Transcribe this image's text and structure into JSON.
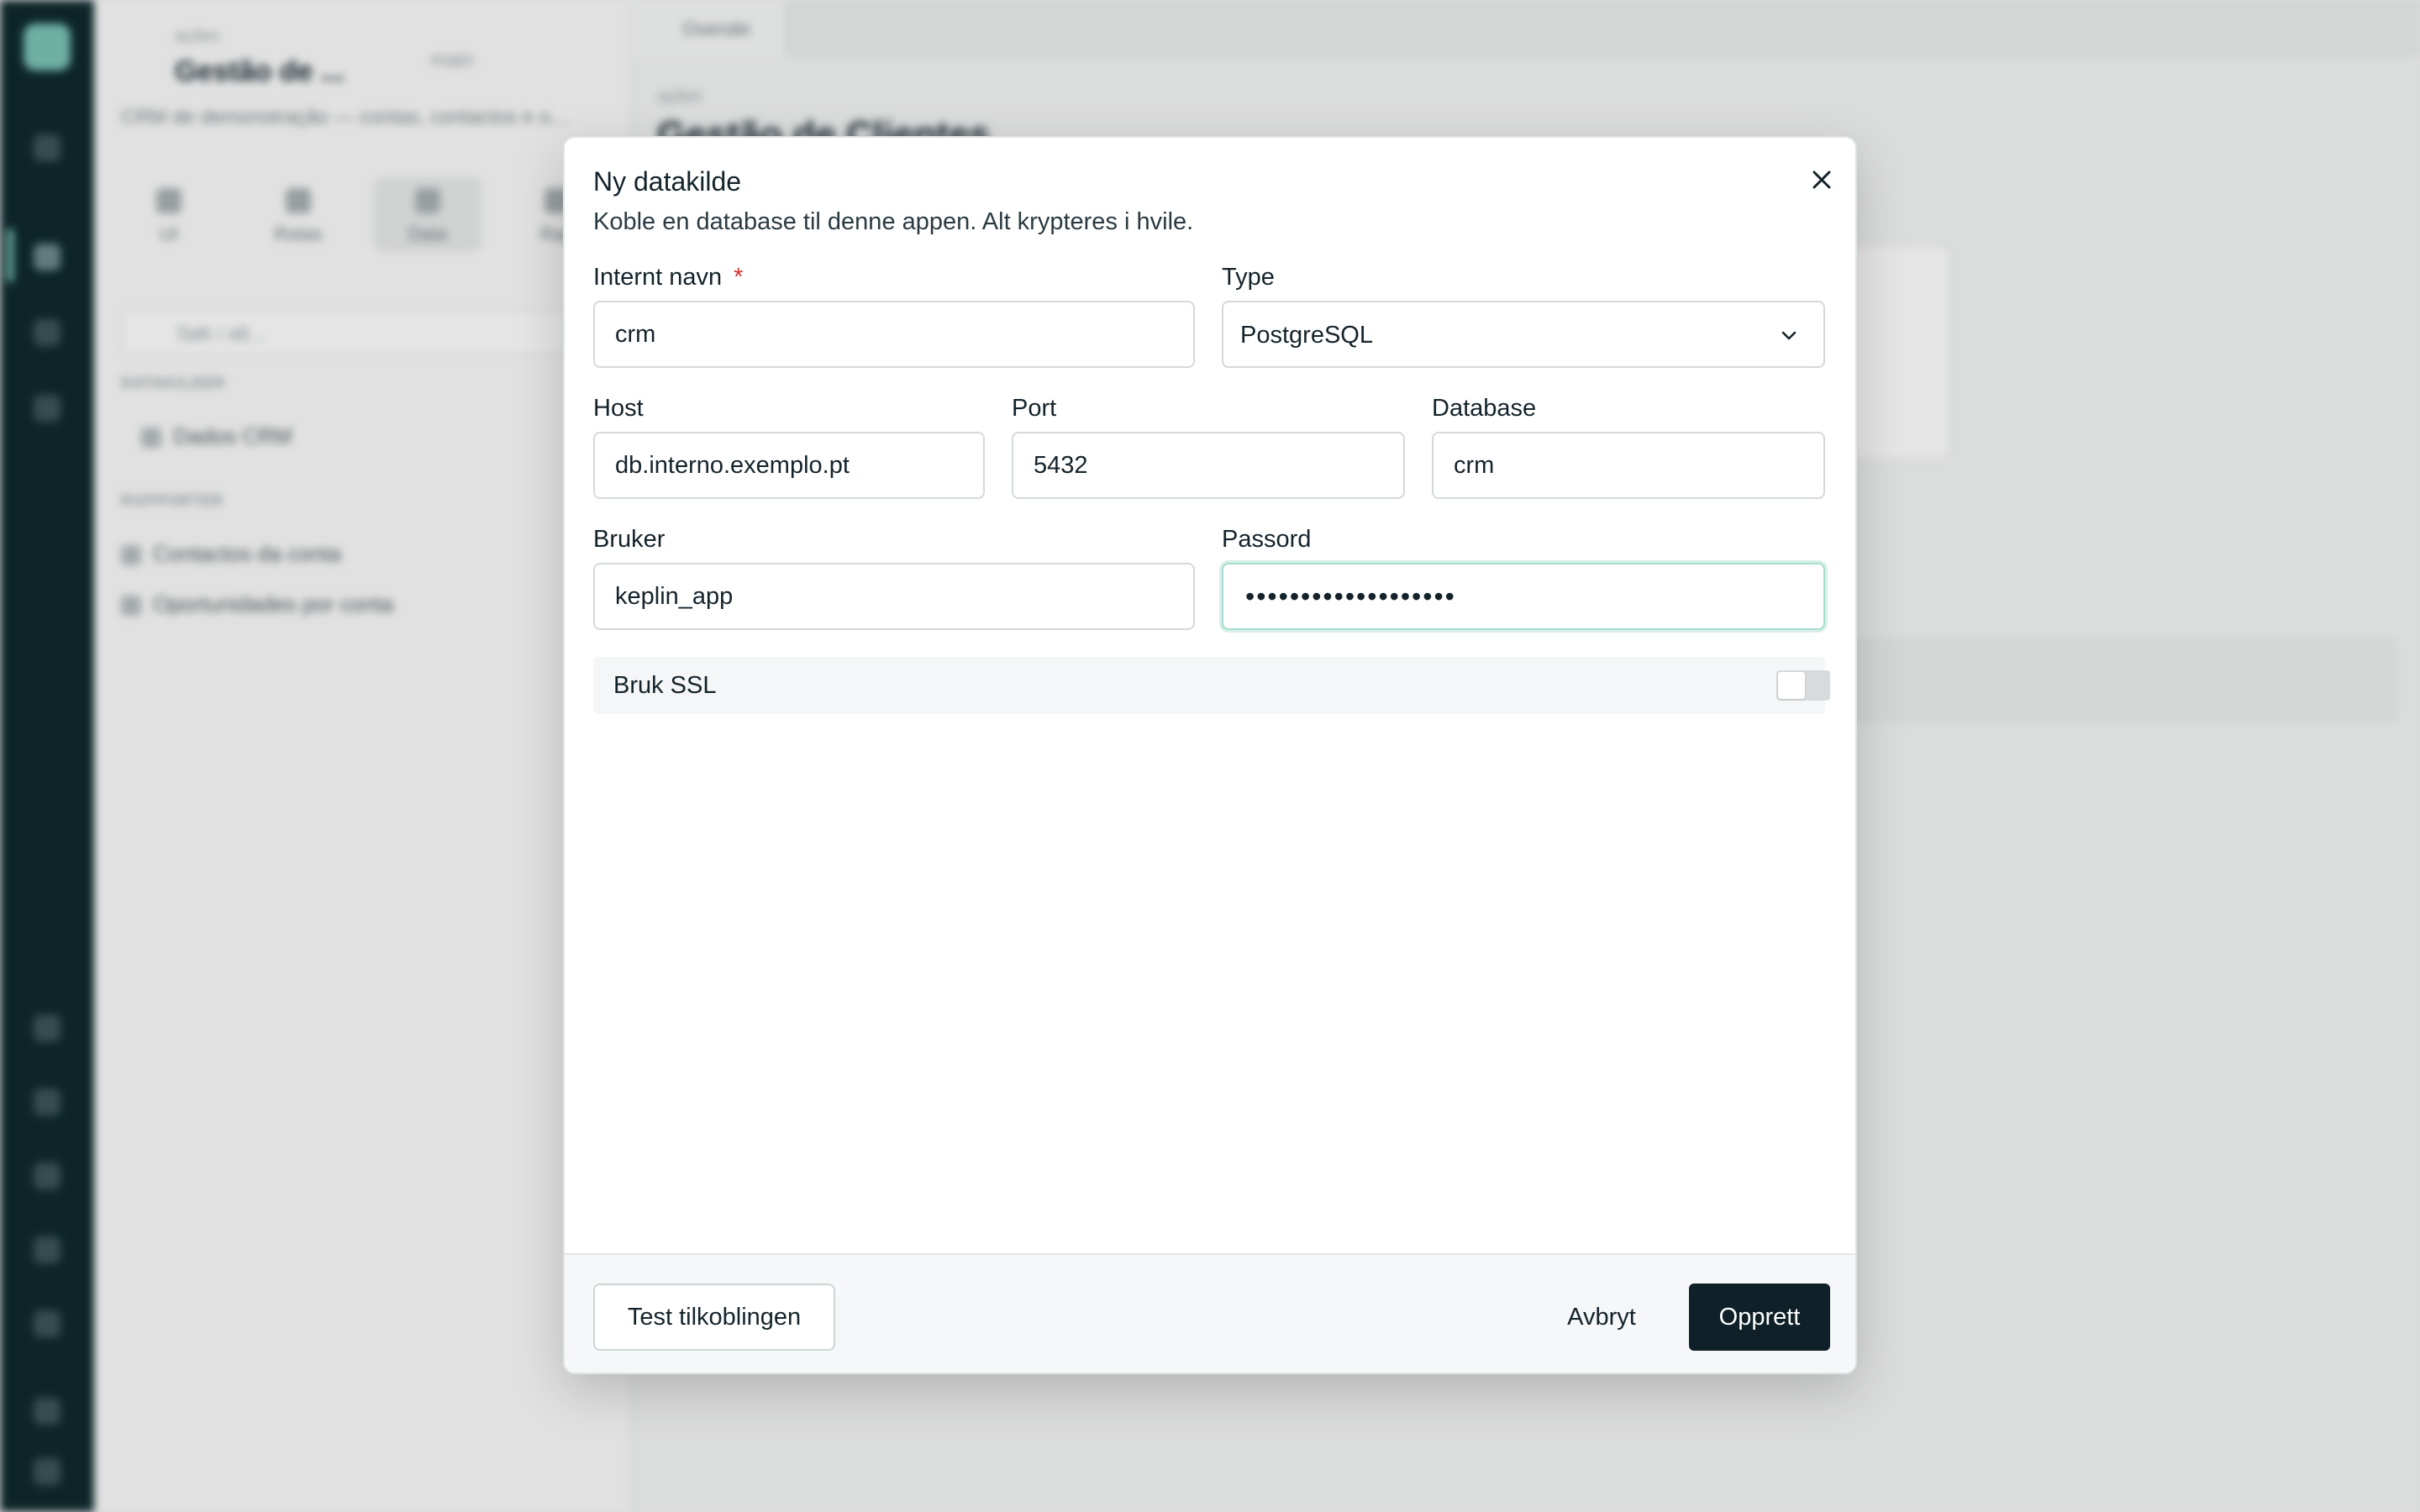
{
  "background": {
    "sidepanel": {
      "workspace_small": "ações",
      "app_title": "Gestão de ...",
      "branch_label": "main",
      "app_description": "CRM de demonstração — contas, contactos e o...",
      "tabs": [
        "UI",
        "Rotas",
        "Data",
        "Rap"
      ],
      "search_placeholder": "Søk i alt...",
      "section_datasources": "DATAKILDER",
      "datasource_item": "Dados CRM",
      "section_reports": "RAPPORTER",
      "report_items": [
        "Contactos da conta",
        "Oportunidades por conta"
      ]
    },
    "main": {
      "tab_label": "Oversikt",
      "small_label": "ações",
      "title": "Gestão de Clientes"
    }
  },
  "modal": {
    "title": "Ny datakilde",
    "description": "Koble en database til denne appen. Alt krypteres i hvile.",
    "fields": {
      "internal_name": {
        "label": "Internt navn",
        "required_mark": "*",
        "value": "crm"
      },
      "type": {
        "label": "Type",
        "value": "PostgreSQL"
      },
      "host": {
        "label": "Host",
        "value": "db.interno.exemplo.pt"
      },
      "port": {
        "label": "Port",
        "value": "5432"
      },
      "database": {
        "label": "Database",
        "value": "crm"
      },
      "user": {
        "label": "Bruker",
        "value": "keplin_app"
      },
      "password": {
        "label": "Passord",
        "masked": "•••••••••••••••••••"
      }
    },
    "ssl": {
      "label": "Bruk SSL",
      "enabled": false
    },
    "footer": {
      "test_label": "Test tilkoblingen",
      "cancel_label": "Avbryt",
      "create_label": "Opprett"
    }
  },
  "colors": {
    "rail": "#0f2a2e",
    "primary_button": "#0f2028",
    "required": "#d32f2f",
    "focus_ring": "#a7dccf"
  },
  "icons": [
    "close-icon",
    "chevron-down-icon"
  ]
}
